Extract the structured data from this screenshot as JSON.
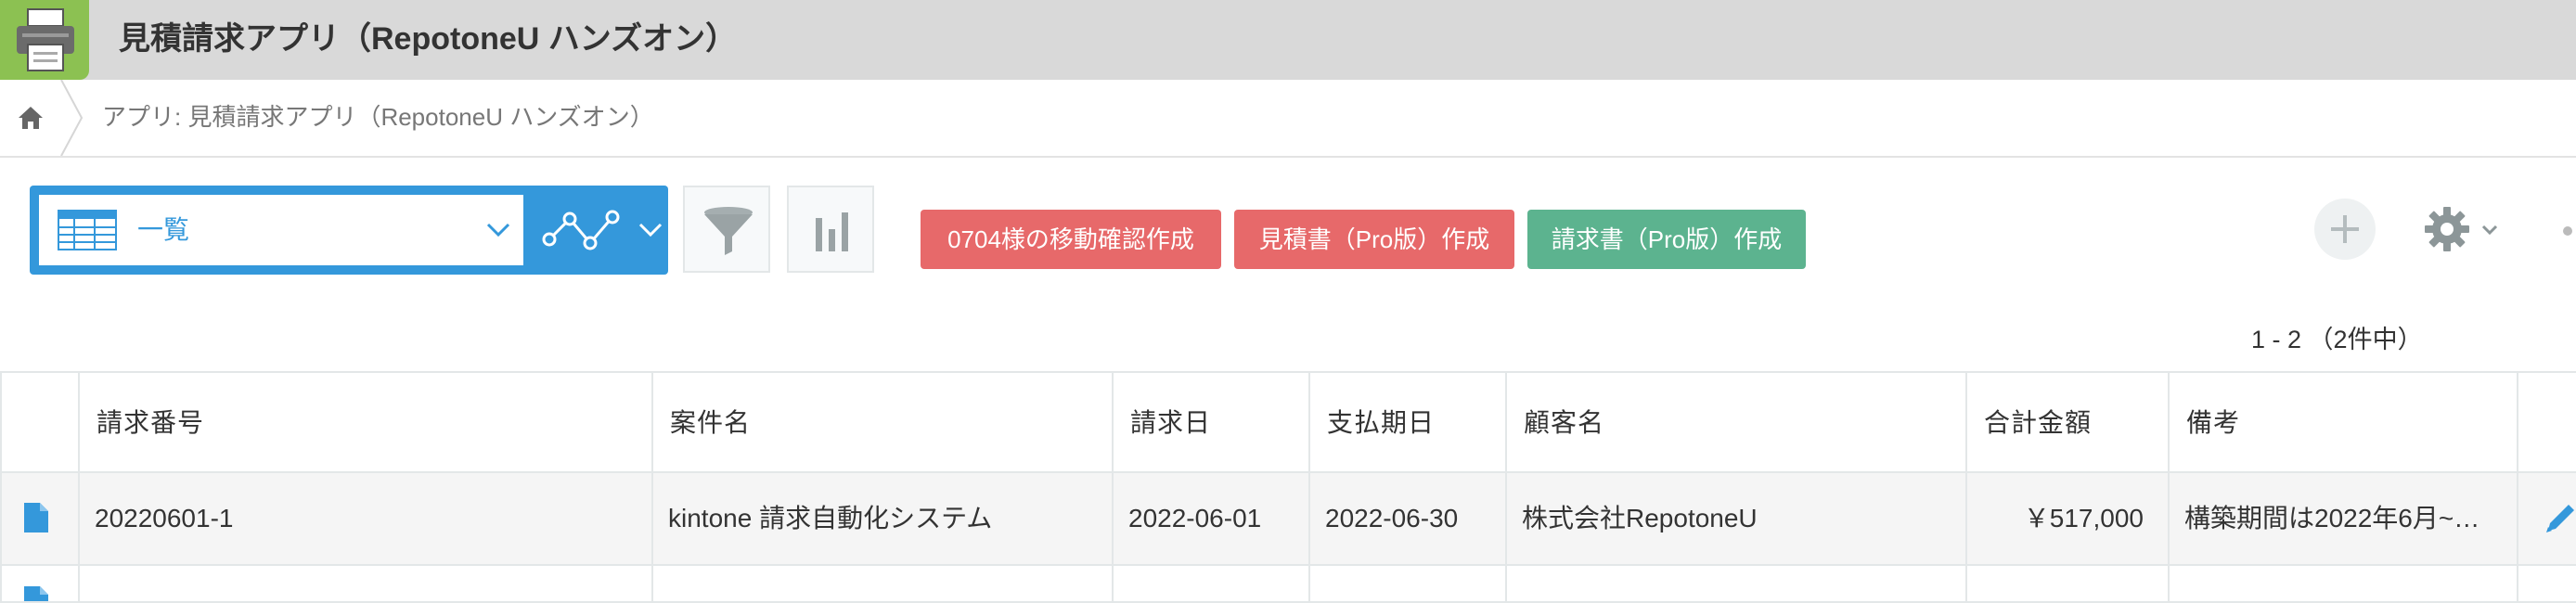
{
  "header": {
    "app_title": "見積請求アプリ（RepotoneU ハンズオン）",
    "app_icon": "printer-icon"
  },
  "breadcrumb": {
    "home_icon": "home-icon",
    "app_label": "アプリ: 見積請求アプリ（RepotoneU ハンズオン）"
  },
  "toolbar": {
    "view_name": "一覧",
    "view_icon": "table-icon",
    "graph_icon": "line-graph-icon",
    "filter_icon": "funnel-icon",
    "chart_icon": "bar-chart-icon",
    "actions": [
      {
        "label": "0704様の移動確認作成",
        "color": "#e7696a"
      },
      {
        "label": "見積書（Pro版）作成",
        "color": "#e7696a"
      },
      {
        "label": "請求書（Pro版）作成",
        "color": "#5cb38f"
      }
    ],
    "add_icon": "plus-icon",
    "settings_icon": "gear-icon"
  },
  "pager": {
    "range": "1 - 2",
    "total": "（2件中）"
  },
  "table": {
    "columns": [
      "請求番号",
      "案件名",
      "請求日",
      "支払期日",
      "顧客名",
      "合計金額",
      "備考"
    ],
    "rows": [
      {
        "invoice_no": "20220601-1",
        "case_name": "kintone 請求自動化システム",
        "invoice_date": "2022-06-01",
        "due_date": "2022-06-30",
        "customer": "株式会社RepotoneU",
        "total": "￥517,000",
        "note": "構築期間は2022年6月~…"
      }
    ]
  },
  "colors": {
    "accent": "#3498db",
    "app_icon_bg": "#8cc152",
    "header_bg": "#d9d9d9"
  }
}
